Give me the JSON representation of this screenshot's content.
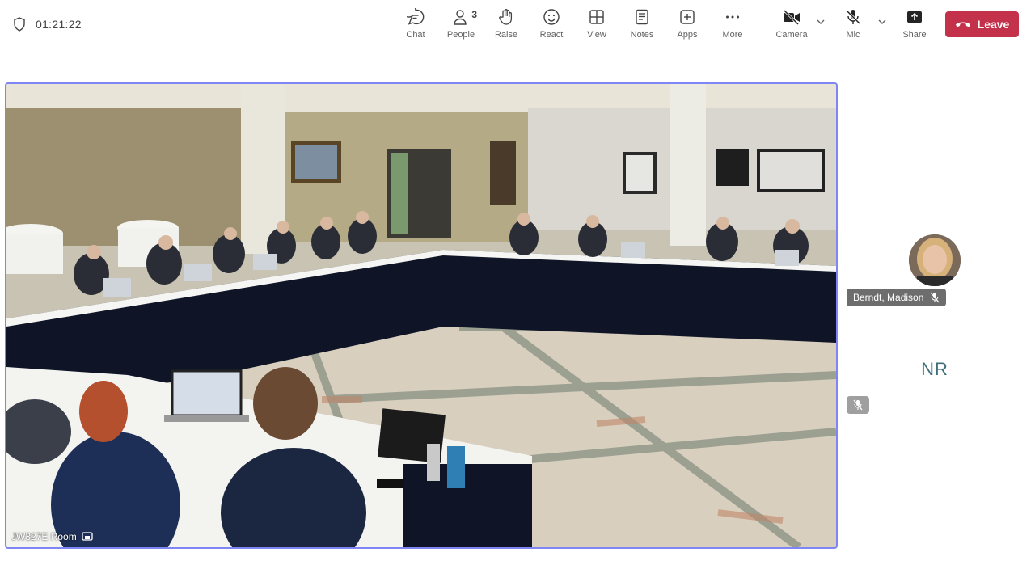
{
  "timer": "01:21:22",
  "toolbar": {
    "chat": "Chat",
    "people": "People",
    "people_count": "3",
    "raise": "Raise",
    "react": "React",
    "view": "View",
    "notes": "Notes",
    "apps": "Apps",
    "more": "More",
    "camera": "Camera",
    "mic": "Mic",
    "share": "Share",
    "leave": "Leave"
  },
  "stage": {
    "room_label": "JW327E Room"
  },
  "participants": [
    {
      "name": "Berndt, Madison",
      "muted": true
    },
    {
      "initials": "NR",
      "muted": true
    }
  ],
  "colors": {
    "accent": "#7f85f5",
    "leave": "#c4314b"
  },
  "icons": [
    "shield-icon",
    "chat-icon",
    "people-icon",
    "hand-icon",
    "smile-icon",
    "grid-icon",
    "notes-icon",
    "apps-icon",
    "more-icon",
    "camera-off-icon",
    "mic-off-icon",
    "share-icon",
    "phone-icon",
    "chevron-down-icon",
    "screen-share-icon"
  ]
}
